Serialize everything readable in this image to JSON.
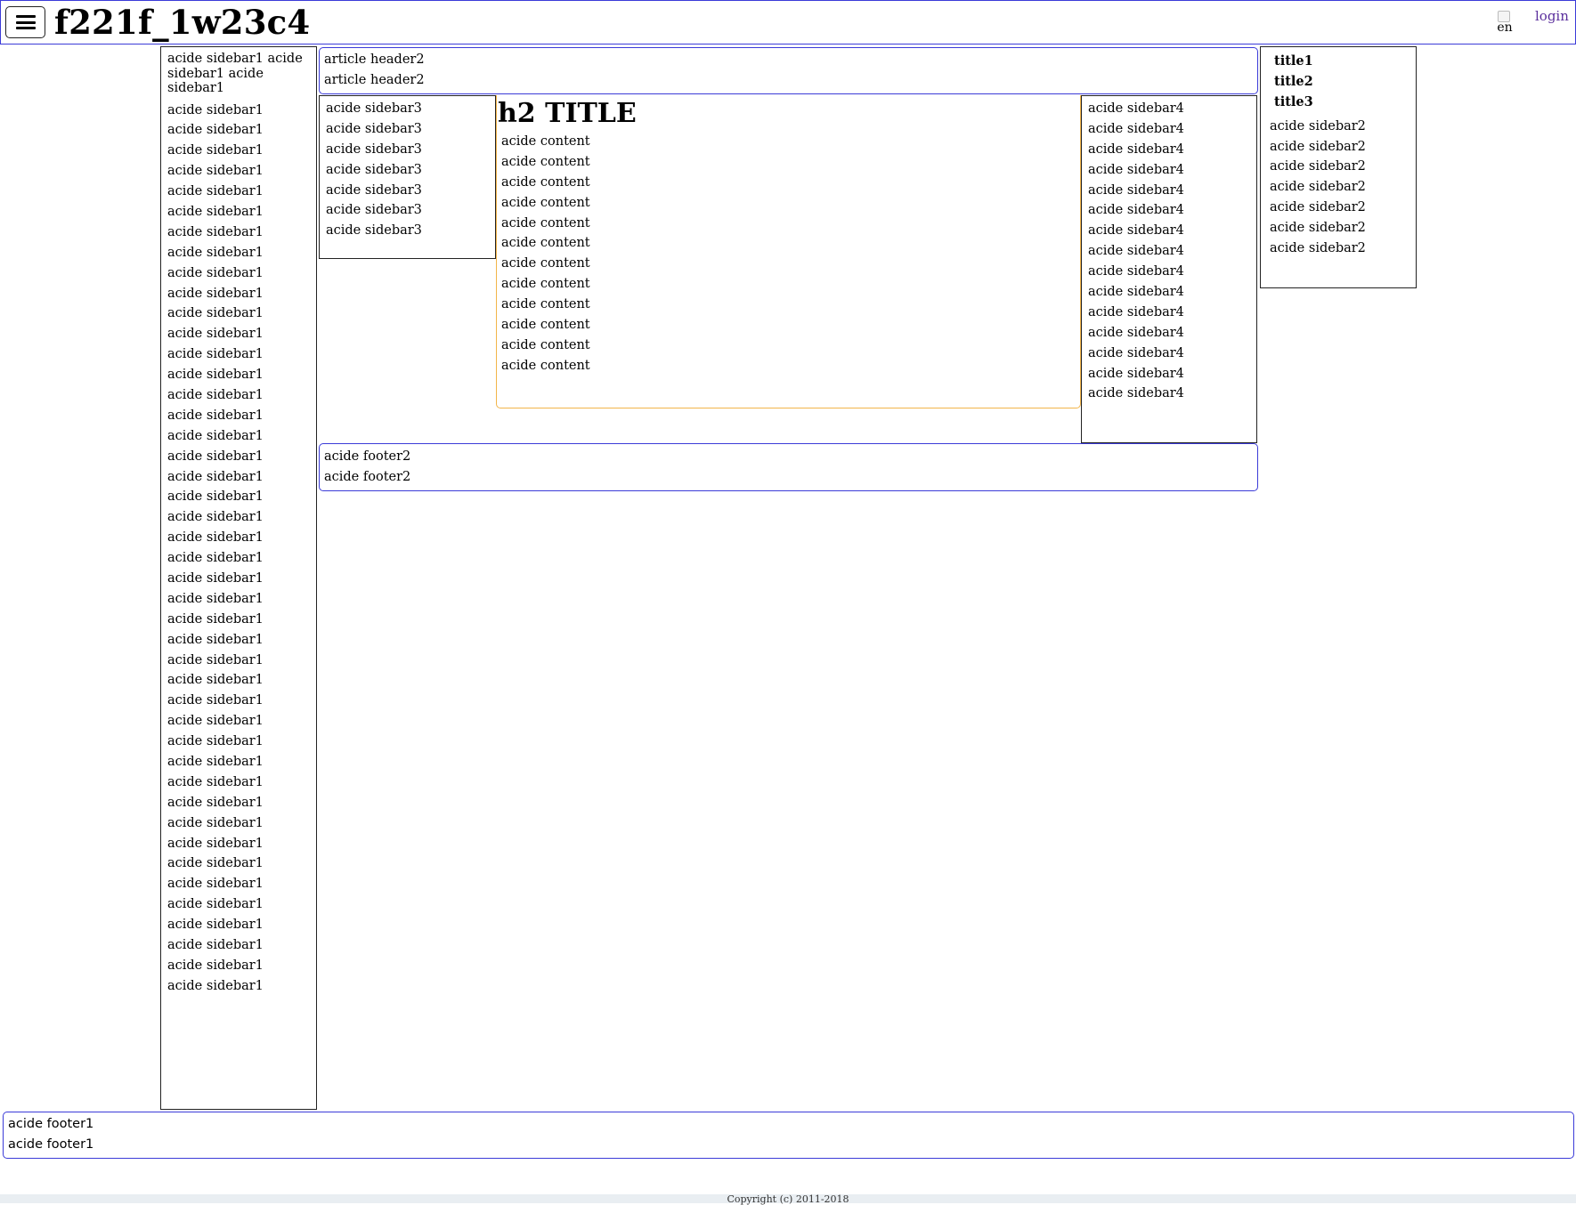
{
  "header": {
    "menu_icon": "hamburger-menu-icon",
    "site_title": "f221f_1w23c4",
    "lang_alt": "en",
    "login_label": "login"
  },
  "sidebar1": {
    "first_item": "acide sidebar1 acide sidebar1 acide sidebar1",
    "items": [
      "acide sidebar1",
      "acide sidebar1",
      "acide sidebar1",
      "acide sidebar1",
      "acide sidebar1",
      "acide sidebar1",
      "acide sidebar1",
      "acide sidebar1",
      "acide sidebar1",
      "acide sidebar1",
      "acide sidebar1",
      "acide sidebar1",
      "acide sidebar1",
      "acide sidebar1",
      "acide sidebar1",
      "acide sidebar1",
      "acide sidebar1",
      "acide sidebar1",
      "acide sidebar1",
      "acide sidebar1",
      "acide sidebar1",
      "acide sidebar1",
      "acide sidebar1",
      "acide sidebar1",
      "acide sidebar1",
      "acide sidebar1",
      "acide sidebar1",
      "acide sidebar1",
      "acide sidebar1",
      "acide sidebar1",
      "acide sidebar1",
      "acide sidebar1",
      "acide sidebar1",
      "acide sidebar1",
      "acide sidebar1",
      "acide sidebar1",
      "acide sidebar1",
      "acide sidebar1",
      "acide sidebar1",
      "acide sidebar1",
      "acide sidebar1",
      "acide sidebar1",
      "acide sidebar1",
      "acide sidebar1"
    ]
  },
  "article_header": {
    "lines": [
      "article header2",
      "article header2"
    ]
  },
  "sidebar3": {
    "items": [
      "acide sidebar3",
      "acide sidebar3",
      "acide sidebar3",
      "acide sidebar3",
      "acide sidebar3",
      "acide sidebar3",
      "acide sidebar3"
    ]
  },
  "content": {
    "title": "h2 TITLE",
    "lines": [
      "acide content",
      "acide content",
      "acide content",
      "acide content",
      "acide content",
      "acide content",
      "acide content",
      "acide content",
      "acide content",
      "acide content",
      "acide content",
      "acide content"
    ]
  },
  "sidebar4": {
    "items": [
      "acide sidebar4",
      "acide sidebar4",
      "acide sidebar4",
      "acide sidebar4",
      "acide sidebar4",
      "acide sidebar4",
      "acide sidebar4",
      "acide sidebar4",
      "acide sidebar4",
      "acide sidebar4",
      "acide sidebar4",
      "acide sidebar4",
      "acide sidebar4",
      "acide sidebar4",
      "acide sidebar4"
    ]
  },
  "sidebar2": {
    "titles": [
      "title1",
      "title2",
      "title3"
    ],
    "items": [
      "acide sidebar2",
      "acide sidebar2",
      "acide sidebar2",
      "acide sidebar2",
      "acide sidebar2",
      "acide sidebar2",
      "acide sidebar2"
    ]
  },
  "footer2": {
    "lines": [
      "acide footer2",
      "acide footer2"
    ]
  },
  "footer1": {
    "lines": [
      "acide footer1",
      "acide footer1"
    ]
  },
  "copyright": "Copyright (c) 2011-2018",
  "colors": {
    "blue_border": "#3b3bd8",
    "orange_border": "#f2b54a",
    "link_purple": "#5a2e9c",
    "dark_border": "#222222"
  }
}
